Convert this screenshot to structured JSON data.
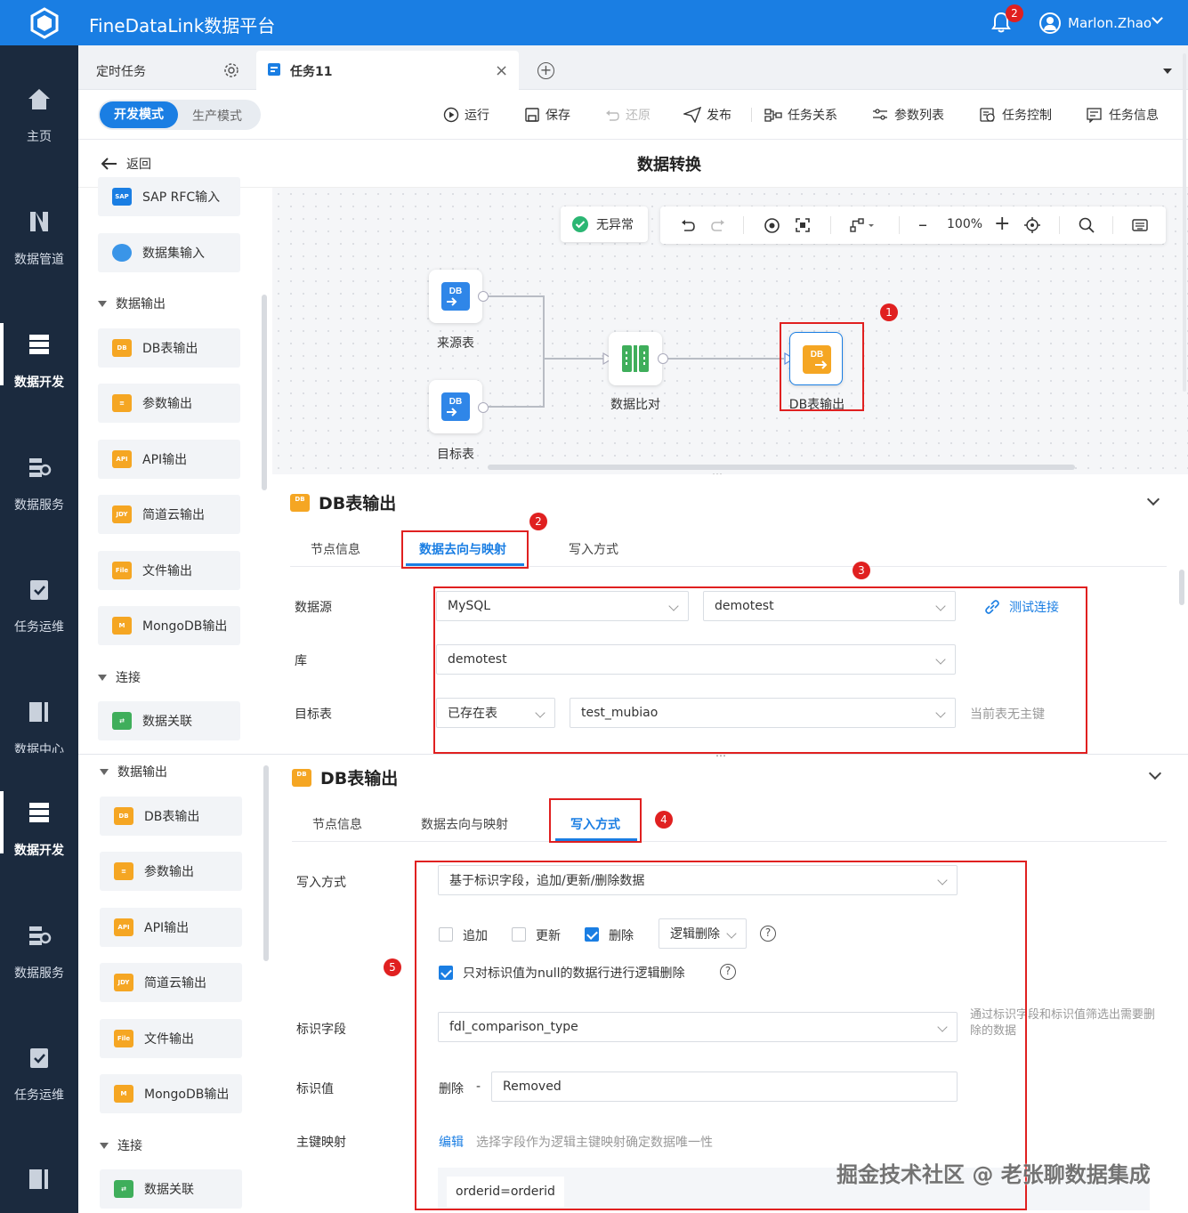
{
  "app": {
    "title": "FineDataLink数据平台",
    "notification_count": "2",
    "user": "Marlon.Zhao"
  },
  "nav": {
    "top": [
      "主页",
      "数据管道",
      "数据开发",
      "数据服务",
      "任务运维",
      "数据中心"
    ],
    "bottom": [
      "数据开发",
      "数据服务",
      "任务运维"
    ]
  },
  "tabs": {
    "scheduled": "定时任务",
    "task": "任务11"
  },
  "toolbar": {
    "dev_mode": "开发模式",
    "prod_mode": "生产模式",
    "run": "运行",
    "save": "保存",
    "restore": "还原",
    "publish": "发布",
    "relation": "任务关系",
    "params": "参数列表",
    "control": "任务控制",
    "info": "任务信息"
  },
  "subheader": {
    "back": "返回",
    "title": "数据转换"
  },
  "components": {
    "top": [
      {
        "label": "SAP RFC输入",
        "icon": "sap-icon"
      },
      {
        "label": "数据集输入",
        "icon": "dataset-icon"
      }
    ],
    "group_output": "数据输出",
    "outputs": [
      {
        "label": "DB表输出",
        "icon": "db-output-icon"
      },
      {
        "label": "参数输出",
        "icon": "param-output-icon"
      },
      {
        "label": "API输出",
        "icon": "api-output-icon"
      },
      {
        "label": "简道云输出",
        "icon": "jdy-output-icon"
      },
      {
        "label": "文件输出",
        "icon": "file-output-icon"
      },
      {
        "label": "MongoDB输出",
        "icon": "mongodb-output-icon"
      }
    ],
    "group_connect": "连接",
    "connect": [
      {
        "label": "数据关联",
        "icon": "join-icon"
      }
    ]
  },
  "canvas": {
    "status": "无异常",
    "zoom": "100%",
    "nodes": {
      "source": "来源表",
      "target": "目标表",
      "compare": "数据比对",
      "output": "DB表输出"
    },
    "node_badge": "DB"
  },
  "panel1": {
    "title": "DB表输出",
    "tabs": [
      "节点信息",
      "数据去向与映射",
      "写入方式"
    ],
    "fields": {
      "datasource_label": "数据源",
      "datasource_type": "MySQL",
      "datasource_conn": "demotest",
      "test_conn": "测试连接",
      "db_label": "库",
      "db_value": "demotest",
      "table_label": "目标表",
      "table_mode": "已存在表",
      "table_value": "test_mubiao",
      "table_hint": "当前表无主键"
    }
  },
  "panel2": {
    "title": "DB表输出",
    "tabs": [
      "节点信息",
      "数据去向与映射",
      "写入方式"
    ],
    "fields": {
      "write_label": "写入方式",
      "write_value": "基于标识字段，追加/更新/删除数据",
      "opt_append": "追加",
      "opt_update": "更新",
      "opt_delete": "删除",
      "delete_mode": "逻辑删除",
      "null_only": "只对标识值为null的数据行进行逻辑删除",
      "flag_field_label": "标识字段",
      "flag_field_value": "fdl_comparison_type",
      "flag_hint": "通过标识字段和标识值筛选出需要删除的数据",
      "flag_value_label": "标识值",
      "flag_value_prefix": "删除",
      "flag_value_sep": "-",
      "flag_value": "Removed",
      "pk_label": "主键映射",
      "pk_edit": "编辑",
      "pk_hint": "选择字段作为逻辑主键映射确定数据唯一性",
      "pk_value": "orderid=orderid"
    }
  },
  "annotations": [
    "1",
    "2",
    "3",
    "4",
    "5"
  ],
  "watermark": "掘金技术社区 @ 老张聊数据集成",
  "colors": {
    "brand": "#1a7ee3",
    "nav_bg": "#1b2a3e",
    "highlight": "#e02020",
    "output_orange": "#f5a623"
  }
}
